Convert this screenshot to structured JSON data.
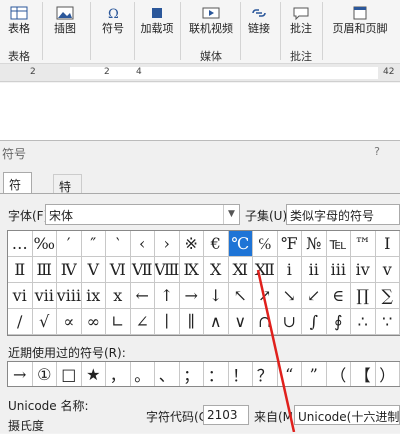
{
  "ribbon": {
    "groups": [
      {
        "button": "表格",
        "label": "表格"
      },
      {
        "button": "插图",
        "label": ""
      },
      {
        "button": "符号",
        "label": ""
      },
      {
        "button": "加载项",
        "label": ""
      },
      {
        "button": "联机视频",
        "label": "媒体"
      },
      {
        "button": "链接",
        "label": ""
      },
      {
        "button": "批注",
        "label": "批注"
      },
      {
        "button": "页眉和页脚",
        "label": ""
      }
    ]
  },
  "ruler": {
    "marks": [
      "2",
      "2",
      "4",
      "42"
    ]
  },
  "dialog": {
    "title": "符号",
    "help": "?",
    "tabs": [
      "符号(S)",
      "特殊字符(P)"
    ],
    "font_label": "字体(F):",
    "font_value": "宋体",
    "subset_label": "子集(U):",
    "subset_value": "类似字母的符号",
    "symbols": [
      "…",
      "‰",
      "′",
      "″",
      "‵",
      "‹",
      "›",
      "※",
      "€",
      "℃",
      "℅",
      "℉",
      "№",
      "℡",
      "™",
      "Ⅰ",
      "Ⅱ",
      "Ⅲ",
      "Ⅳ",
      "Ⅴ",
      "Ⅵ",
      "Ⅶ",
      "Ⅷ",
      "Ⅸ",
      "Ⅹ",
      "Ⅺ",
      "Ⅻ",
      "ⅰ",
      "ⅱ",
      "ⅲ",
      "ⅳ",
      "ⅴ",
      "ⅵ",
      "ⅶ",
      "ⅷ",
      "ⅸ",
      "ⅹ",
      "←",
      "↑",
      "→",
      "↓",
      "↖",
      "↗",
      "↘",
      "↙",
      "∈",
      "∏",
      "∑",
      "∕",
      "√",
      "∝",
      "∞",
      "∟",
      "∠",
      "∣",
      "∥",
      "∧",
      "∨",
      "∩",
      "∪",
      "∫",
      "∮",
      "∴",
      "∵"
    ],
    "selected_index": 9,
    "recent_label": "近期使用过的符号(R):",
    "recent": [
      "→",
      "①",
      "□",
      "★",
      "，",
      "。",
      "、",
      "；",
      "：",
      "！",
      "？",
      "“",
      "”",
      "（",
      "【",
      "）"
    ],
    "unicode_name_label": "Unicode 名称:",
    "unicode_name_value": "摄氏度",
    "char_code_label": "字符代码(C):",
    "char_code_value": "2103",
    "from_label": "来自(M):",
    "from_value": "Unicode(十六进制)"
  },
  "colors": {
    "selection": "#1e74d6",
    "annotation": "#e0201c"
  }
}
